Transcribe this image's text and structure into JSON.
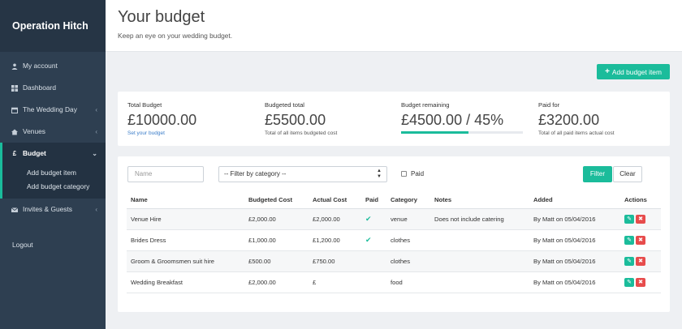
{
  "sidebar": {
    "brand": "Operation Hitch",
    "items": [
      {
        "label": "My account",
        "icon": "user-icon"
      },
      {
        "label": "Dashboard",
        "icon": "dashboard-icon"
      },
      {
        "label": "The Wedding Day",
        "icon": "calendar-icon"
      },
      {
        "label": "Venues",
        "icon": "home-icon"
      },
      {
        "label": "Budget",
        "icon": "pound-icon"
      },
      {
        "label": "Invites & Guests",
        "icon": "envelope-icon"
      }
    ],
    "submenu": [
      "Add budget item",
      "Add budget category"
    ],
    "logout": "Logout"
  },
  "header": {
    "title": "Your budget",
    "subtitle": "Keep an eye on your wedding budget."
  },
  "add_button": "Add budget item",
  "stats": {
    "total": {
      "label": "Total Budget",
      "value": "£10000.00",
      "link": "Set your budget"
    },
    "budgeted": {
      "label": "Budgeted total",
      "value": "£5500.00",
      "note": "Total of all items budgeted cost"
    },
    "remaining": {
      "label": "Budget remaining",
      "value": "£4500.00 / 45%",
      "progress": 0.55
    },
    "paid": {
      "label": "Paid for",
      "value": "£3200.00",
      "note": "Total of all paid items actual cost"
    }
  },
  "filters": {
    "name_placeholder": "Name",
    "category_select": "-- Filter by category --",
    "paid_label": "Paid",
    "filter_button": "Filter",
    "clear_button": "Clear"
  },
  "table": {
    "headers": [
      "Name",
      "Budgeted Cost",
      "Actual Cost",
      "Paid",
      "Category",
      "Notes",
      "Added",
      "Actions"
    ],
    "rows": [
      {
        "name": "Venue Hire",
        "budgeted": "£2,000.00",
        "actual": "£2,000.00",
        "paid": true,
        "category": "venue",
        "notes": "Does not include catering",
        "added": "By Matt on 05/04/2016"
      },
      {
        "name": "Brides Dress",
        "budgeted": "£1,000.00",
        "actual": "£1,200.00",
        "paid": true,
        "category": "clothes",
        "notes": "",
        "added": "By Matt on 05/04/2016"
      },
      {
        "name": "Groom & Groomsmen suit hire",
        "budgeted": "£500.00",
        "actual": "£750.00",
        "paid": false,
        "category": "clothes",
        "notes": "",
        "added": "By Matt on 05/04/2016"
      },
      {
        "name": "Wedding Breakfast",
        "budgeted": "£2,000.00",
        "actual": "£",
        "paid": false,
        "category": "food",
        "notes": "",
        "added": "By Matt on 05/04/2016"
      }
    ]
  },
  "colors": {
    "accent": "#1bbc9b",
    "sidebar": "#2e3f51",
    "danger": "#e74c4c"
  }
}
